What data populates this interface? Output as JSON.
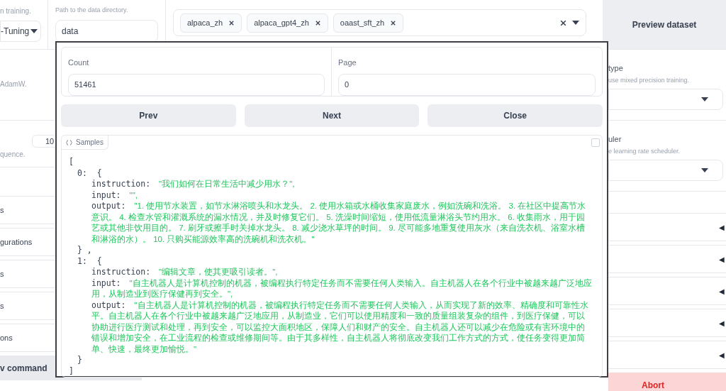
{
  "top_row": {
    "left_hint": "n training.",
    "left_select": "-Tuning",
    "data_dir": {
      "hint": "Path to the data directory.",
      "value": "data"
    },
    "dataset": {
      "chips": [
        "alpaca_zh",
        "alpaca_gpt4_zh",
        "oaast_sft_zh"
      ]
    },
    "preview_button": "Preview dataset"
  },
  "left_column": {
    "hint_1": "AdamW.",
    "number_value": "10",
    "hint_2": "quence.",
    "accordions": [
      "s",
      "gurations",
      "s",
      "s",
      "ons"
    ],
    "command_button": "v command"
  },
  "right_column": {
    "panels": [
      {
        "label": "type",
        "hint": "use mixed precision training."
      },
      {
        "label": "uler",
        "hint": "e learning rate scheduler."
      }
    ],
    "accordion_count_marks": [
      "◀",
      "◀",
      "◀",
      "◀",
      "◀"
    ],
    "abort_button": "Abort"
  },
  "modal": {
    "count": {
      "label": "Count",
      "value": "51461"
    },
    "page": {
      "label": "Page",
      "value": "0"
    },
    "buttons": [
      "Prev",
      "Next",
      "Close"
    ],
    "samples": {
      "label": "Samples",
      "open": "[",
      "close": "]",
      "items": [
        {
          "index": "0:",
          "open": "{",
          "close": "} ,",
          "fields": [
            {
              "key": "instruction:",
              "value": "\"我们如何在日常生活中减少用水？\","
            },
            {
              "key": "input:",
              "value": "\"\","
            },
            {
              "key": "output:",
              "value": "\"1. 使用节水装置，如节水淋浴喷头和水龙头。 2. 使用水箱或水桶收集家庭废水，例如洗碗和洗浴。 3. 在社区中提高节水意识。 4. 检查水管和灌溉系统的漏水情况，并及时修复它们。 5. 洗澡时间缩短，使用低流量淋浴头节约用水。 6. 收集雨水，用于园艺或其他非饮用目的。 7. 刷牙或擦手时关掉水龙头。 8. 减少浇水草坪的时间。 9. 尽可能多地重复使用灰水（来自洗衣机、浴室水槽和淋浴的水）。 10. 只购买能源效率高的洗碗机和洗衣机。\""
            }
          ]
        },
        {
          "index": "1:",
          "open": "{",
          "close": "}",
          "fields": [
            {
              "key": "instruction:",
              "value": "\"编辑文章，使其更吸引读者。\","
            },
            {
              "key": "input:",
              "value": "\"自主机器人是计算机控制的机器，被编程执行特定任务而不需要任何人类输入。自主机器人在各个行业中被越来越广泛地应用，从制造业到医疗保健再到安全。\","
            },
            {
              "key": "output:",
              "value": "\"自主机器人是计算机控制的机器，被编程执行特定任务而不需要任何人类输入，从而实现了新的效率、精确度和可靠性水平。自主机器人在各个行业中被越来越广泛地应用，从制造业，它们可以使用精度和一致的质量组装复杂的组件，到医疗保健，可以协助进行医疗测试和处理，再到安全，可以监控大面积地区，保障人们和财产的安全。自主机器人还可以减少在危险或有害环境中的错误和增加安全，在工业流程的检查或维修期间等。由于其多样性，自主机器人将彻底改变我们工作方式的方式，使任务变得更加简单、快速，最终更加愉悦。\""
            }
          ]
        }
      ]
    }
  }
}
